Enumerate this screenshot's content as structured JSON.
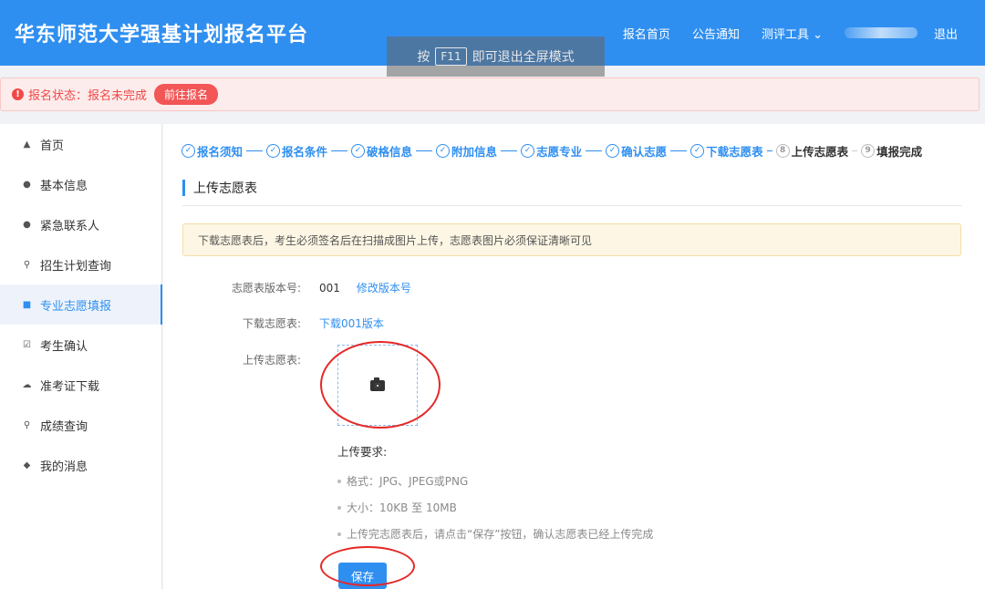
{
  "header": {
    "brand": "华东师范大学强基计划报名平台",
    "nav": [
      "报名首页",
      "公告通知",
      "测评工具 ⌄"
    ],
    "logout": "退出",
    "fullscreen_hint_pre": "按",
    "fullscreen_hint_key": "F11",
    "fullscreen_hint_post": "即可退出全屏模式"
  },
  "alert": {
    "icon": "!",
    "status_text": "报名状态：报名未完成",
    "button_label": "前往报名"
  },
  "sidebar": {
    "items": [
      {
        "icon": "home-icon",
        "glyph": "▲",
        "label": "首页"
      },
      {
        "icon": "user-icon",
        "glyph": "●",
        "label": "基本信息"
      },
      {
        "icon": "user-icon",
        "glyph": "●",
        "label": "紧急联系人"
      },
      {
        "icon": "search-icon",
        "glyph": "⚲",
        "label": "招生计划查询"
      },
      {
        "icon": "document-icon",
        "glyph": "■",
        "label": "专业志愿填报",
        "active": true
      },
      {
        "icon": "checkbox-icon",
        "glyph": "☑",
        "label": "考生确认"
      },
      {
        "icon": "cloud-download-icon",
        "glyph": "☁",
        "label": "准考证下载"
      },
      {
        "icon": "search-icon",
        "glyph": "⚲",
        "label": "成绩查询"
      },
      {
        "icon": "bell-icon",
        "glyph": "◆",
        "label": "我的消息"
      }
    ]
  },
  "steps": [
    {
      "label": "报名须知",
      "mark": "✓",
      "done": true
    },
    {
      "label": "报名条件",
      "mark": "✓",
      "done": true
    },
    {
      "label": "破格信息",
      "mark": "✓",
      "done": true
    },
    {
      "label": "附加信息",
      "mark": "✓",
      "done": true
    },
    {
      "label": "志愿专业",
      "mark": "✓",
      "done": true
    },
    {
      "label": "确认志愿",
      "mark": "✓",
      "done": true
    },
    {
      "label": "下载志愿表",
      "mark": "✓",
      "done": true
    },
    {
      "label": "上传志愿表",
      "mark": "8",
      "done": false
    },
    {
      "label": "填报完成",
      "mark": "9",
      "done": false
    }
  ],
  "section_title": "上传志愿表",
  "notice": "下载志愿表后，考生必须签名后在扫描成图片上传，志愿表图片必须保证清晰可见",
  "form": {
    "version_label": "志愿表版本号:",
    "version_value": "001",
    "modify_link": "修改版本号",
    "download_label": "下载志愿表:",
    "download_link": "下载001版本",
    "upload_label": "上传志愿表:"
  },
  "requirements": {
    "title": "上传要求:",
    "items": [
      "格式：JPG、JPEG或PNG",
      "大小：10KB 至 10MB",
      "上传完志愿表后，请点击“保存”按钮，确认志愿表已经上传完成"
    ]
  },
  "save_label": "保存",
  "colors": {
    "primary": "#2f8ff0",
    "danger": "#f14848",
    "annotation": "#e52828"
  }
}
